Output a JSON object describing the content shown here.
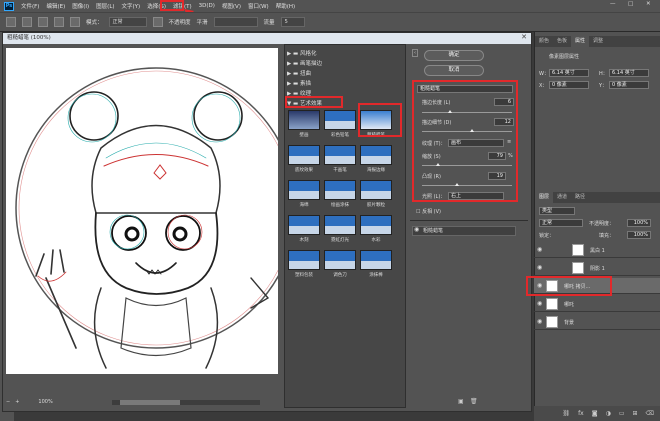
{
  "menubar": {
    "logo": "Ps",
    "items": [
      "文件(F)",
      "编辑(E)",
      "图像(I)",
      "图层(L)",
      "文字(Y)",
      "选择(S)",
      "滤镜(T)",
      "3D(D)",
      "视图(V)",
      "窗口(W)",
      "帮助(H)"
    ],
    "win_min": "—",
    "win_max": "□",
    "win_close": "✕"
  },
  "options": {
    "label_mode": "模式：",
    "mode": "正常",
    "label_opacity": "不透明度",
    "label_smooth": "平滑",
    "sel_placeholder": "",
    "label_flow": "流量",
    "flow_val": "5"
  },
  "dialog": {
    "title": "粗糙蜡笔 (100%)",
    "close": "✕"
  },
  "gallery": {
    "folders": [
      "风格化",
      "画笔描边",
      "扭曲",
      "素描",
      "纹理",
      "艺术效果"
    ],
    "thumbs": [
      "壁画",
      "彩色铅笔",
      "粗糙蜡笔",
      "底纹效果",
      "干画笔",
      "海报边缘",
      "海绵",
      "绘画涂抹",
      "胶片颗粒",
      "木刻",
      "霓虹灯光",
      "水彩",
      "塑料包装",
      "调色刀",
      "涂抹棒"
    ]
  },
  "params": {
    "ok": "确定",
    "cancel": "取消",
    "filter_select": "粗糙蜡笔",
    "stroke_length_label": "描边长度 (L)",
    "stroke_length": "6",
    "stroke_detail_label": "描边细节 (D)",
    "stroke_detail": "12",
    "texture_label": "纹理 (T)：",
    "texture": "画布",
    "scale_label": "缩放 (S)",
    "scale": "79",
    "scale_unit": "%",
    "relief_label": "凸现 (R)",
    "relief": "19",
    "light_label": "光照 (L)：",
    "light": "右上",
    "invert_label": "反相 (V)",
    "effect_layer": "粗糙蜡笔"
  },
  "bottom": {
    "zoom": "100%",
    "minus": "−",
    "plus": "+"
  },
  "rightpanel": {
    "tabs1": [
      "颜色",
      "色板",
      "属性",
      "调整"
    ],
    "props_title": "像素图层属性",
    "w_label": "W：",
    "w_val": "6.14 英寸",
    "h_label": "H：",
    "h_val": "6.14 英寸",
    "x_label": "X：",
    "x_val": "0 像素",
    "y_label": "Y：",
    "y_val": "0 像素",
    "tabs2": [
      "图层",
      "通道",
      "路径"
    ],
    "kind": "类型",
    "blend": "正常",
    "opacity_label": "不透明度：",
    "opacity": "100%",
    "lock_label": "锁定：",
    "fill_label": "填充：",
    "fill": "100%",
    "layers": [
      "黑白 1",
      "阴影 1",
      "哪吒 拷贝...",
      "哪吒",
      "背景"
    ]
  }
}
